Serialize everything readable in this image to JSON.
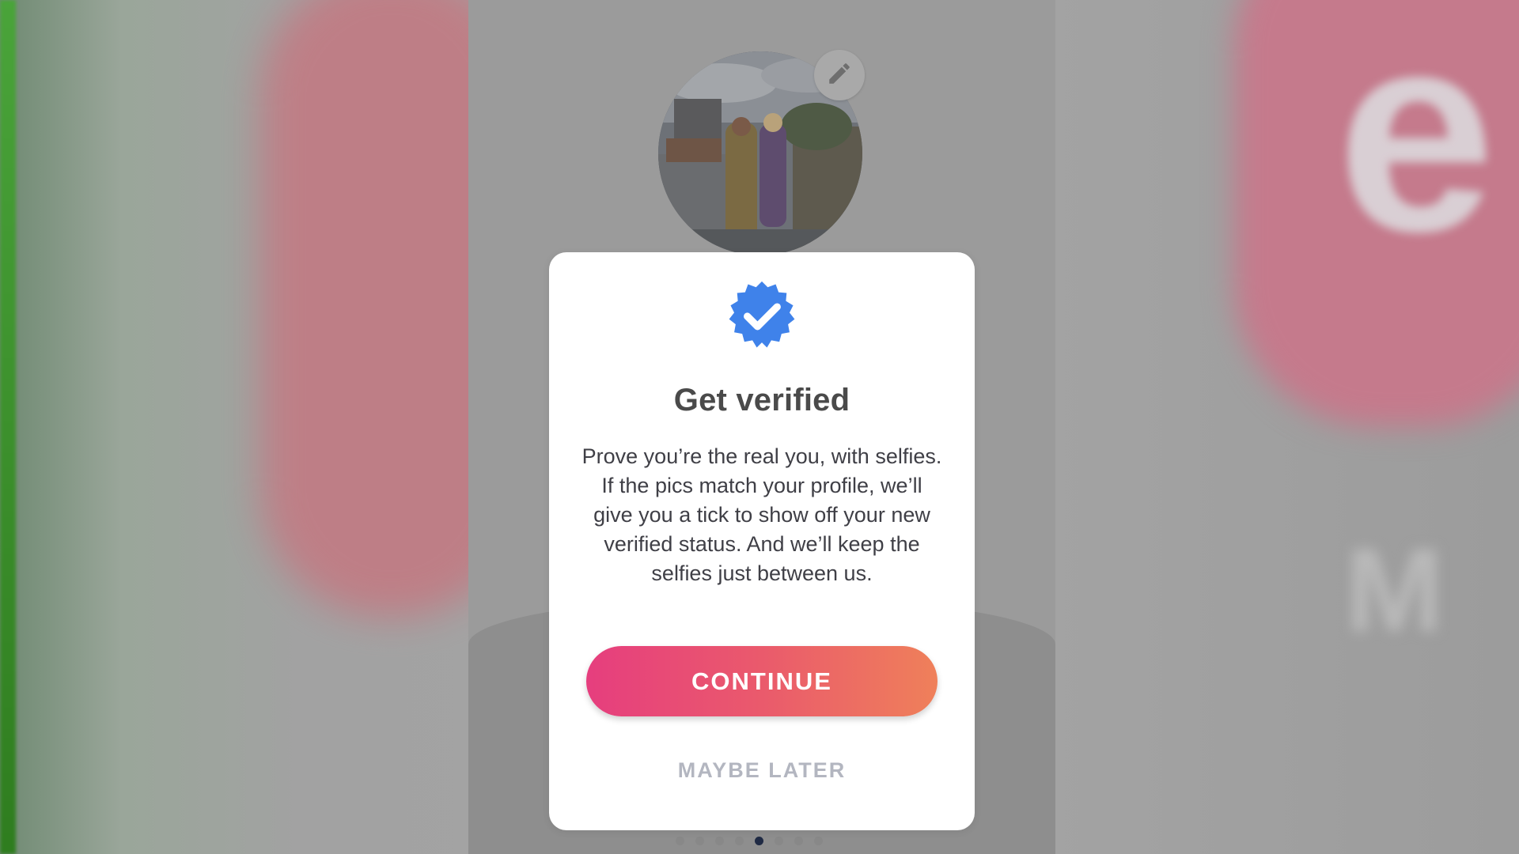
{
  "modal": {
    "title": "Get verified",
    "body": "Prove you’re the real you, with selfies. If the pics match your profile, we’ll give you a tick to show off your new verified status. And we’ll keep the selfies just between us.",
    "primary_button": "CONTINUE",
    "secondary_button": "MAYBE LATER"
  },
  "pagination": {
    "total": 8,
    "active_index": 4
  },
  "icons": {
    "badge": "verified-badge-icon",
    "edit": "pencil-icon"
  },
  "colors": {
    "badge_blue": "#3f82ea",
    "button_gradient_start": "#e63e7e",
    "button_gradient_end": "#ef805a",
    "title_text": "#4a4a4a",
    "secondary_text": "#b3b6c0"
  }
}
